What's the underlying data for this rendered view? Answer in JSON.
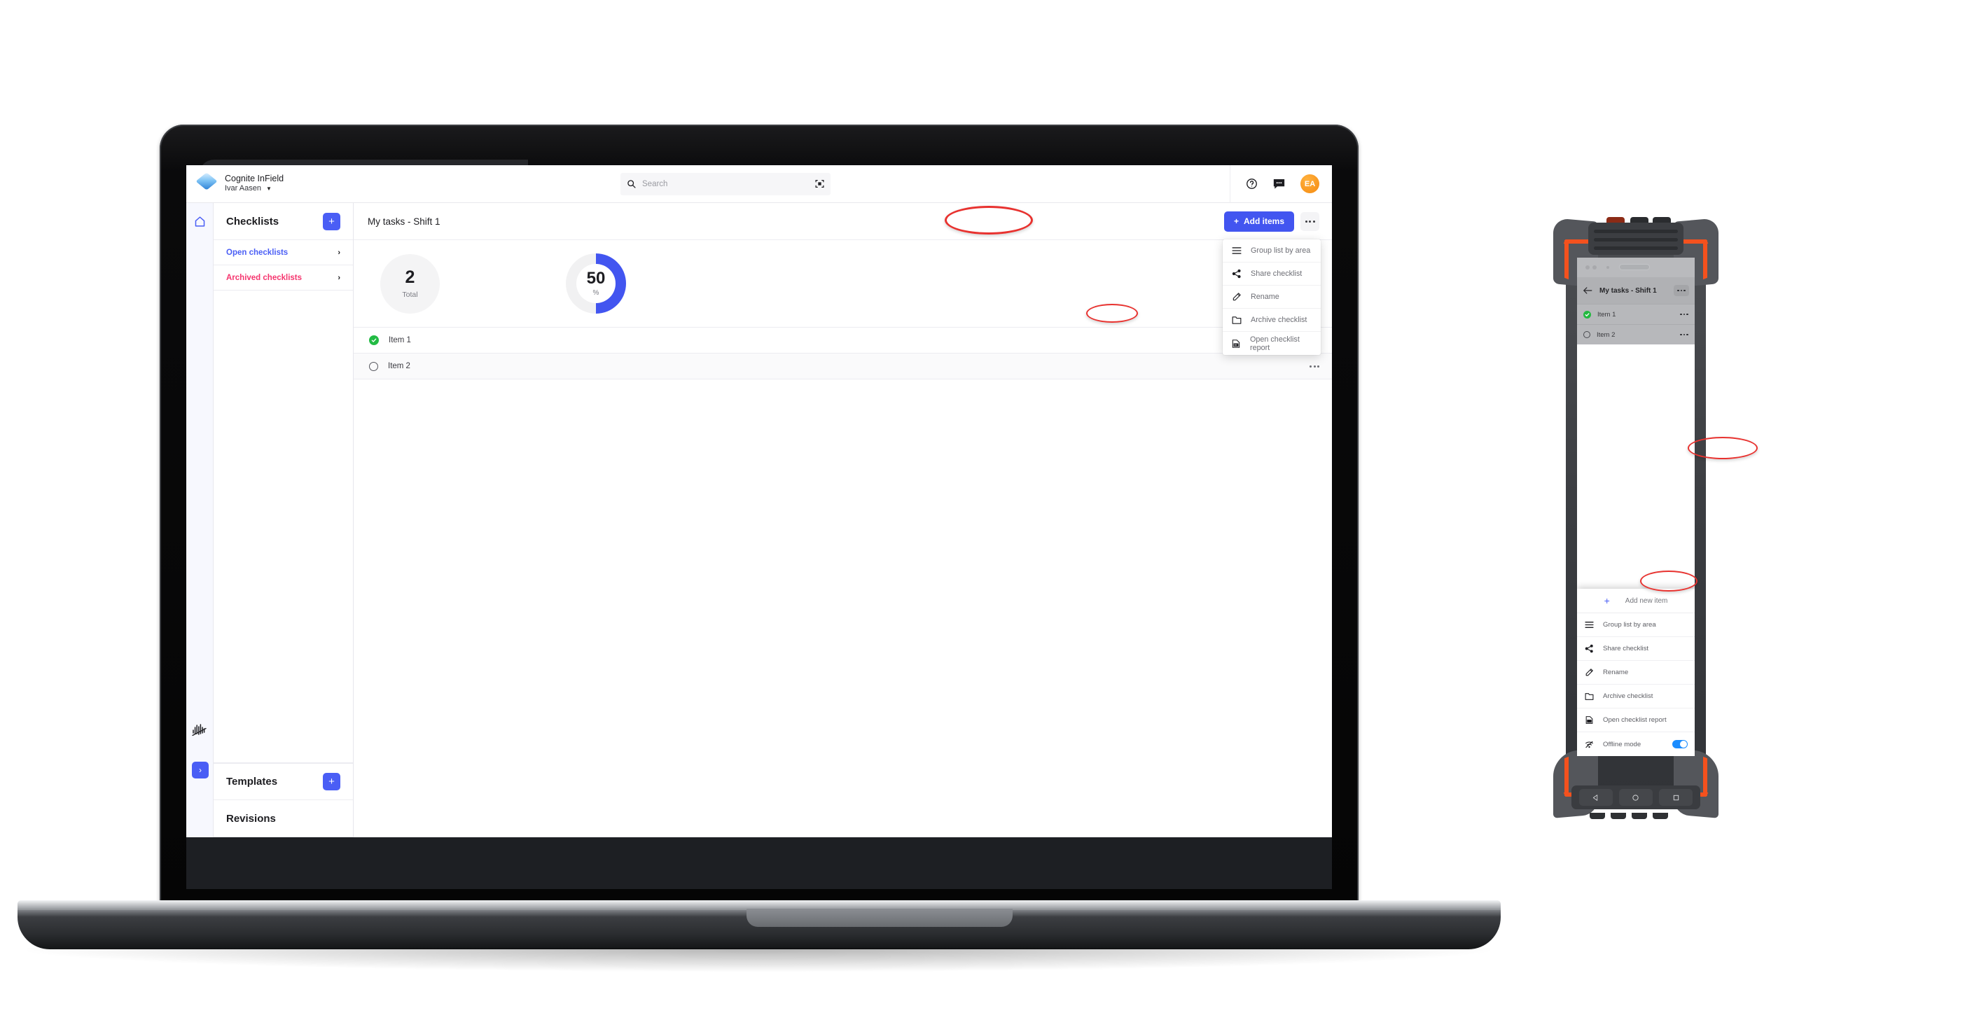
{
  "app": {
    "brand_title": "Cognite InField",
    "brand_subtitle": "Ivar Aasen",
    "search_placeholder": "Search",
    "avatar_initials": "EA"
  },
  "sidebar": {
    "rail_icons": [
      "home-icon",
      "sparkline-icon",
      "expand-icon"
    ],
    "header": "Checklists",
    "add_label": "+",
    "items": [
      {
        "label": "Open checklists",
        "color": "#4a5ef5"
      },
      {
        "label": "Archived checklists",
        "color": "#f5356e"
      }
    ],
    "templates_header": "Templates",
    "templates_add_label": "+",
    "revisions_header": "Revisions"
  },
  "main": {
    "title": "My tasks - Shift 1",
    "add_items_label": "Add items",
    "add_items_plus": "+",
    "stats": {
      "total_value": "2",
      "total_label": "Total",
      "percent_value": "50",
      "percent_label": "%"
    },
    "tasks": [
      {
        "label": "Item 1",
        "state": "done"
      },
      {
        "label": "Item 2",
        "state": "open"
      }
    ]
  },
  "desktop_menu": {
    "items": [
      {
        "label": "Group list by area",
        "icon": "list-icon"
      },
      {
        "label": "Share checklist",
        "icon": "share-icon"
      },
      {
        "label": "Rename",
        "icon": "pencil-icon"
      },
      {
        "label": "Archive checklist",
        "icon": "folder-icon"
      },
      {
        "label": "Open checklist report",
        "icon": "report-icon"
      }
    ]
  },
  "phone": {
    "title": "My tasks - Shift 1",
    "tasks": [
      {
        "label": "Item 1",
        "state": "done"
      },
      {
        "label": "Item 2",
        "state": "open"
      }
    ],
    "add_new_plus": "+",
    "add_new_label": "Add new item",
    "menu_items": [
      {
        "label": "Group list by area",
        "icon": "list-icon",
        "toggle": false
      },
      {
        "label": "Share checklist",
        "icon": "share-icon",
        "toggle": false
      },
      {
        "label": "Rename",
        "icon": "pencil-icon",
        "toggle": false
      },
      {
        "label": "Archive checklist",
        "icon": "folder-icon",
        "toggle": false
      },
      {
        "label": "Open checklist report",
        "icon": "report-icon",
        "toggle": false
      },
      {
        "label": "Offline mode",
        "icon": "offline-icon",
        "toggle": true
      }
    ],
    "nav_buttons": [
      "back-icon",
      "home-icon",
      "recents-icon"
    ]
  },
  "colors": {
    "accent_blue": "#4255f0",
    "archived_pink": "#f5356e",
    "done_green": "#22bb44",
    "avatar_orange": "#f58a10",
    "annotation_red": "#e8322f",
    "phone_accent_orange": "#f4511e"
  }
}
